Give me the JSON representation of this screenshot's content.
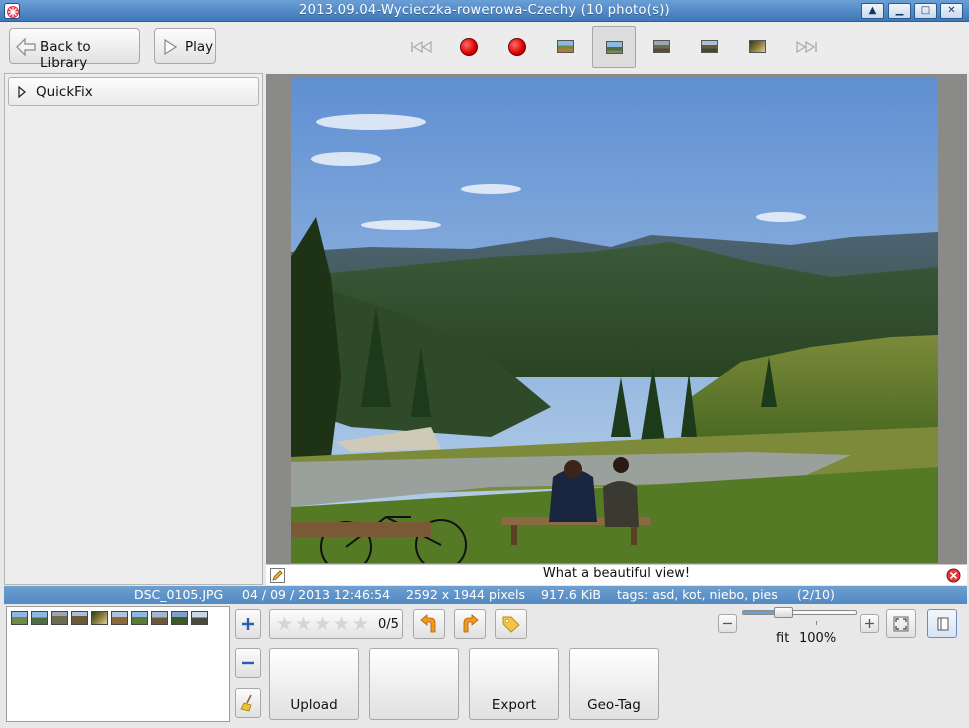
{
  "window": {
    "title": "2013.09.04-Wycieczka-rowerowa-Czechy (10 photo(s))",
    "buttons": [
      "up-arrow",
      "minimize",
      "maximize",
      "close"
    ]
  },
  "toolbar": {
    "back_label": "Back to Library",
    "play_label": "Play"
  },
  "left_panel": {
    "quickfix_label": "QuickFix"
  },
  "caption": {
    "text": "What a beautiful view!"
  },
  "info": {
    "filename": "DSC_0105.JPG",
    "datetime": "04 / 09 / 2013 12:46:54",
    "dimensions": "2592 x 1944 pixels",
    "filesize": "917.6 KiB",
    "tags": "tags: asd, kot, niebo, pies",
    "position": "(2/10)"
  },
  "rating": {
    "value": 0,
    "max": 5,
    "label": "0/5"
  },
  "actions": {
    "upload_label": "Upload",
    "blank_label": "",
    "export_label": "Export",
    "geotag_label": "Geo-Tag"
  },
  "zoom": {
    "fit_label": "fit",
    "percent_label": "100%",
    "slider_value": 0.3
  },
  "colors": {
    "titlebar": "#3f78b8",
    "infobar": "#5b8fc7"
  }
}
